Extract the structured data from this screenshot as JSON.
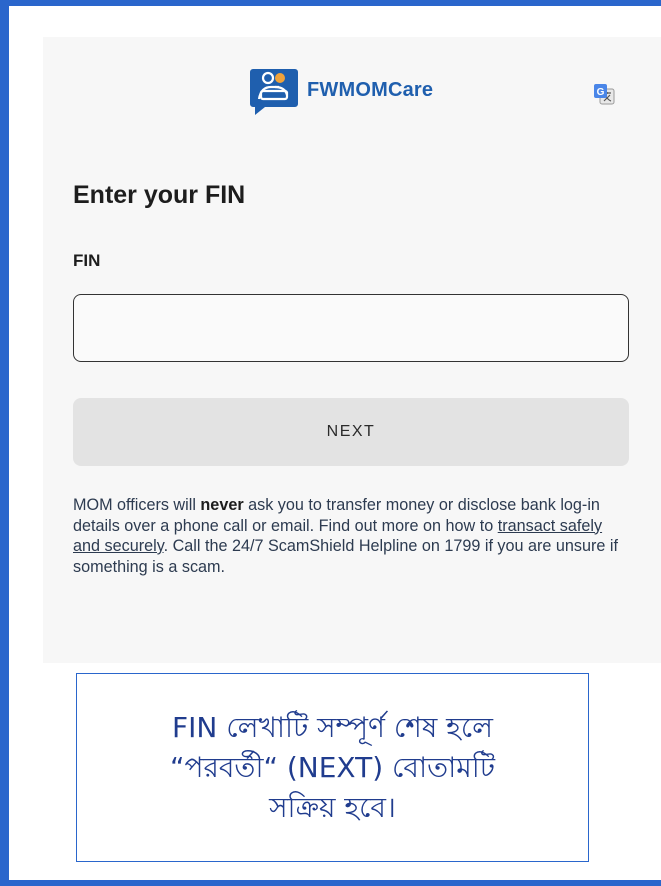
{
  "app": {
    "name": "FWMOMCare"
  },
  "header": {
    "translate_icon": "google-translate-icon"
  },
  "page": {
    "title": "Enter your FIN"
  },
  "form": {
    "fin_label": "FIN",
    "fin_value": "",
    "fin_placeholder": "",
    "next_label": "NEXT"
  },
  "notice": {
    "part1": "MOM officers will ",
    "emphasis": "never",
    "part2": " ask you to transfer money or disclose bank log-in details over a phone call or email. Find out more on how to ",
    "link": "transact safely and securely",
    "part3": ". Call the 24/7 ScamShield Helpline on 1799 if you are unsure if something is a scam."
  },
  "caption": {
    "line1": "FIN লেখাটি সম্পূর্ণ শেষ হলে",
    "line2": "“পরবর্তী“ (NEXT) বোতামটি",
    "line3": "সক্রিয় হবে।"
  },
  "colors": {
    "brand": "#1f5fae",
    "frame": "#2a66cc",
    "caption_text": "#203c8e",
    "button_disabled": "#e3e3e3"
  }
}
